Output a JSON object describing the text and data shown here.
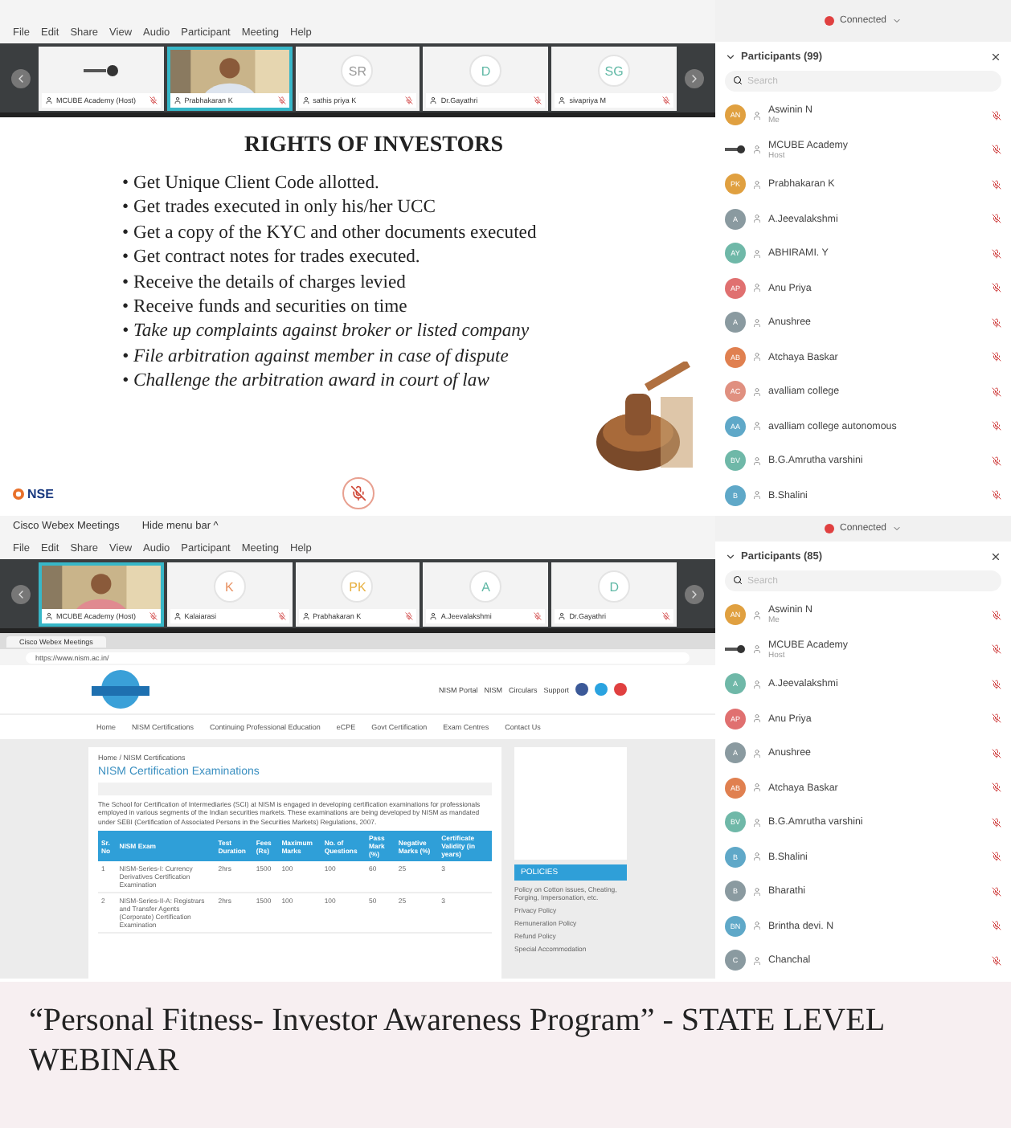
{
  "screenshots": [
    {
      "menu": [
        "File",
        "Edit",
        "Share",
        "View",
        "Audio",
        "Participant",
        "Meeting",
        "Help"
      ],
      "video_tiles": [
        {
          "kind": "logo",
          "name": "MCUBE Academy (Host)",
          "selected": false
        },
        {
          "kind": "video",
          "name": "Prabhakaran K",
          "selected": true
        },
        {
          "kind": "initials",
          "initials": "SR",
          "color": "#9a9a9a",
          "name": "sathis priya K",
          "selected": false
        },
        {
          "kind": "initials",
          "initials": "D",
          "color": "#5fb8a5",
          "name": "Dr.Gayathri",
          "selected": false
        },
        {
          "kind": "initials",
          "initials": "SG",
          "color": "#5fb8a5",
          "name": "sivapriya M",
          "selected": false
        }
      ],
      "content": {
        "kind": "slide",
        "title": "RIGHTS OF INVESTORS",
        "logo": "NSE",
        "bullets": [
          {
            "text": "• Get Unique Client Code allotted.",
            "italic": false
          },
          {
            "text": "• Get trades executed in only his/her UCC",
            "italic": false
          },
          {
            "text": "• Get a copy of the KYC and other documents executed",
            "italic": false
          },
          {
            "text": "• Get contract notes for trades executed.",
            "italic": false
          },
          {
            "text": "• Receive the details of charges levied",
            "italic": false
          },
          {
            "text": "• Receive funds and securities on time",
            "italic": false
          },
          {
            "text": "• Take up complaints against broker or listed company",
            "italic": true
          },
          {
            "text": "• File arbitration against member in case of dispute",
            "italic": true
          },
          {
            "text": "• Challenge the arbitration award in court of law",
            "italic": true
          }
        ]
      },
      "status": "Connected",
      "participants": {
        "title": "Participants (99)",
        "placeholder": "Search",
        "items": [
          {
            "kind": "initials",
            "initials": "AN",
            "color": "#e0a040",
            "name": "Aswinin N",
            "role": "Me"
          },
          {
            "kind": "logo",
            "name": "MCUBE Academy",
            "role": "Host"
          },
          {
            "kind": "initials",
            "initials": "PK",
            "color": "#e0a040",
            "name": "Prabhakaran K"
          },
          {
            "kind": "initials",
            "initials": "A",
            "color": "#8a9aa0",
            "name": "A.Jeevalakshmi"
          },
          {
            "kind": "initials",
            "initials": "AY",
            "color": "#6fb8a8",
            "name": "ABHIRAMI. Y"
          },
          {
            "kind": "initials",
            "initials": "AP",
            "color": "#e07070",
            "name": "Anu Priya"
          },
          {
            "kind": "initials",
            "initials": "A",
            "color": "#8a9aa0",
            "name": "Anushree"
          },
          {
            "kind": "initials",
            "initials": "AB",
            "color": "#e08050",
            "name": "Atchaya Baskar"
          },
          {
            "kind": "initials",
            "initials": "AC",
            "color": "#e09080",
            "name": "avalliam college"
          },
          {
            "kind": "initials",
            "initials": "AA",
            "color": "#5fa8c8",
            "name": "avalliam college autonomous"
          },
          {
            "kind": "initials",
            "initials": "BV",
            "color": "#6fb8a8",
            "name": "B.G.Amrutha varshini"
          },
          {
            "kind": "initials",
            "initials": "B",
            "color": "#5fa8c8",
            "name": "B.Shalini"
          }
        ]
      }
    },
    {
      "title": "Cisco Webex Meetings",
      "hide_menu": "Hide menu bar ^",
      "menu": [
        "File",
        "Edit",
        "Share",
        "View",
        "Audio",
        "Participant",
        "Meeting",
        "Help"
      ],
      "video_tiles": [
        {
          "kind": "video",
          "name": "MCUBE Academy (Host)",
          "selected": true
        },
        {
          "kind": "initials",
          "initials": "K",
          "color": "#e89060",
          "name": "Kalaiarasi",
          "selected": false
        },
        {
          "kind": "initials",
          "initials": "PK",
          "color": "#e8b040",
          "name": "Prabhakaran K",
          "selected": false
        },
        {
          "kind": "initials",
          "initials": "A",
          "color": "#5fb8a5",
          "name": "A.Jeevalakshmi",
          "selected": false
        },
        {
          "kind": "initials",
          "initials": "D",
          "color": "#5fb8a5",
          "name": "Dr.Gayathri",
          "selected": false
        }
      ],
      "content": {
        "kind": "browser",
        "tab": "Cisco Webex Meetings",
        "url": "https://www.nism.ac.in/",
        "top_links": [
          "NISM Portal",
          "NISM",
          "Circulars",
          "Support"
        ],
        "nav": [
          "Home",
          "NISM Certifications",
          "Continuing Professional Education",
          "eCPE",
          "Govt Certification",
          "Exam Centres",
          "Contact Us"
        ],
        "breadcrumb": "Home / NISM Certifications",
        "heading": "NISM Certification Examinations",
        "paragraph": "The School for Certification of Intermediaries (SCI) at NISM is engaged in developing certification examinations for professionals employed in various segments of the Indian securities markets. These examinations are being developed by NISM as mandated under SEBI (Certification of Associated Persons in the Securities Markets) Regulations, 2007.",
        "table": {
          "columns": [
            "Sr. No",
            "NISM Exam",
            "Test Duration",
            "Fees (Rs)",
            "Maximum Marks",
            "No. of Questions",
            "Pass Mark (%)",
            "Negative Marks (%)",
            "Certificate Validity (in years)"
          ],
          "rows": [
            [
              "1",
              "NISM-Series-I: Currency Derivatives Certification Examination",
              "2hrs",
              "1500",
              "100",
              "100",
              "60",
              "25",
              "3"
            ],
            [
              "2",
              "NISM-Series-II-A: Registrars and Transfer Agents (Corporate) Certification Examination",
              "2hrs",
              "1500",
              "100",
              "100",
              "50",
              "25",
              "3"
            ]
          ]
        },
        "policies_title": "POLICIES",
        "policies": [
          "Policy on Cotton issues, Cheating, Forging, Impersonation, etc.",
          "Privacy Policy",
          "Remuneration Policy",
          "Refund Policy",
          "Special Accommodation"
        ]
      },
      "status": "Connected",
      "participants": {
        "title": "Participants (85)",
        "placeholder": "Search",
        "items": [
          {
            "kind": "initials",
            "initials": "AN",
            "color": "#e0a040",
            "name": "Aswinin N",
            "role": "Me"
          },
          {
            "kind": "logo",
            "name": "MCUBE Academy",
            "role": "Host"
          },
          {
            "kind": "initials",
            "initials": "A",
            "color": "#6fb8a8",
            "name": "A.Jeevalakshmi"
          },
          {
            "kind": "initials",
            "initials": "AP",
            "color": "#e07070",
            "name": "Anu Priya"
          },
          {
            "kind": "initials",
            "initials": "A",
            "color": "#8a9aa0",
            "name": "Anushree"
          },
          {
            "kind": "initials",
            "initials": "AB",
            "color": "#e08050",
            "name": "Atchaya Baskar"
          },
          {
            "kind": "initials",
            "initials": "BV",
            "color": "#6fb8a8",
            "name": "B.G.Amrutha varshini"
          },
          {
            "kind": "initials",
            "initials": "B",
            "color": "#5fa8c8",
            "name": "B.Shalini"
          },
          {
            "kind": "initials",
            "initials": "B",
            "color": "#8a9aa0",
            "name": "Bharathi"
          },
          {
            "kind": "initials",
            "initials": "BN",
            "color": "#5fa8c8",
            "name": "Brintha devi. N"
          },
          {
            "kind": "initials",
            "initials": "C",
            "color": "#8a9aa0",
            "name": "Chanchal"
          }
        ]
      }
    }
  ],
  "caption": "“Personal Fitness- Investor Awareness Program” - STATE LEVEL WEBINAR"
}
